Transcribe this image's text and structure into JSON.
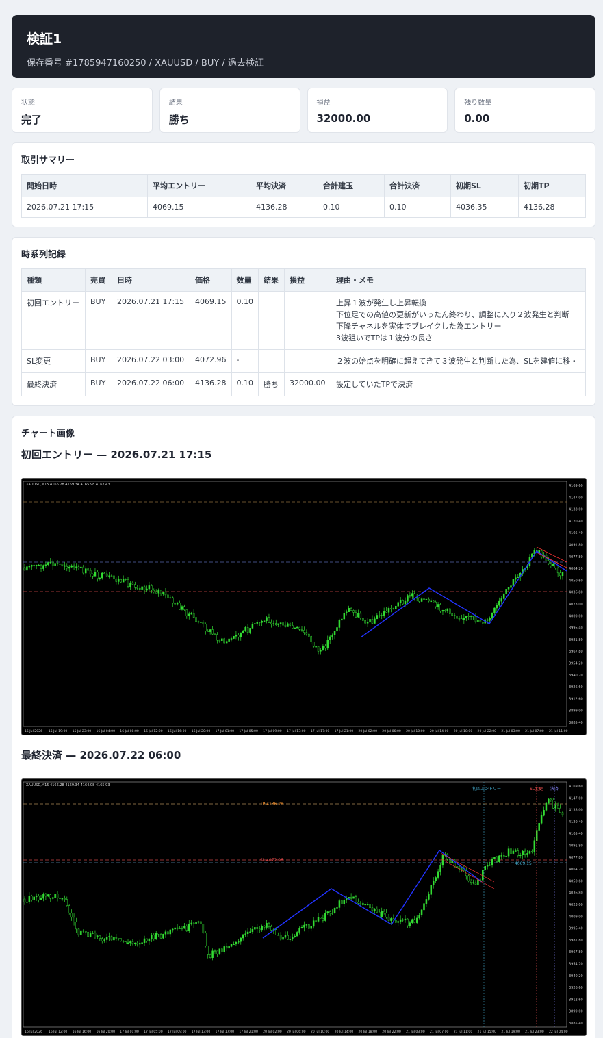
{
  "header": {
    "title": "検証1",
    "subtitle": "保存番号 #1785947160250 / XAUUSD / BUY / 過去検証"
  },
  "stats": [
    {
      "label": "状態",
      "value": "完了"
    },
    {
      "label": "結果",
      "value": "勝ち"
    },
    {
      "label": "損益",
      "value": "32000.00"
    },
    {
      "label": "残り数量",
      "value": "0.00"
    }
  ],
  "summary": {
    "title": "取引サマリー",
    "headers": [
      "開始日時",
      "平均エントリー",
      "平均決済",
      "合計建玉",
      "合計決済",
      "初期SL",
      "初期TP"
    ],
    "row": [
      "2026.07.21 17:15",
      "4069.15",
      "4136.28",
      "0.10",
      "0.10",
      "4036.35",
      "4136.28"
    ]
  },
  "timeline": {
    "title": "時系列記録",
    "headers": [
      "種類",
      "売買",
      "日時",
      "価格",
      "数量",
      "結果",
      "損益",
      "理由・メモ"
    ],
    "rows": [
      {
        "cells": [
          "初回エントリー",
          "BUY",
          "2026.07.21 17:15",
          "4069.15",
          "0.10",
          "",
          ""
        ],
        "memo": [
          "上昇１波が発生し上昇転換",
          "下位足での高値の更新がいったん終わり、調整に入り２波発生と判断",
          "下降チャネルを実体でブレイクした為エントリー",
          "3波狙いでTPは１波分の長さ"
        ]
      },
      {
        "cells": [
          "SL変更",
          "BUY",
          "2026.07.22 03:00",
          "4072.96",
          "-",
          "",
          ""
        ],
        "memo": [
          "２波の始点を明確に超えてきて３波発生と判断した為、SLを建値に移・"
        ]
      },
      {
        "cells": [
          "最終決済",
          "BUY",
          "2026.07.22 06:00",
          "4136.28",
          "0.10",
          "勝ち",
          "32000.00"
        ],
        "memo": [
          "設定していたTPで決済"
        ]
      }
    ]
  },
  "charts_section": {
    "title": "チャート画像",
    "charts": [
      {
        "heading": "初回エントリー — 2026.07.21 17:15",
        "info": "XAUUSD,M15  4166.28 4169.34 4165.98 4167.43",
        "y_ticks": [
          "4169.60",
          "4147.00",
          "4133.00",
          "4120.40",
          "4105.40",
          "4091.80",
          "4077.80",
          "4064.20",
          "4050.60",
          "4036.80",
          "4023.00",
          "4009.00",
          "3995.40",
          "3981.80",
          "3967.80",
          "3954.20",
          "3940.20",
          "3926.60",
          "3912.60",
          "3899.00",
          "3885.40"
        ],
        "x_ticks": [
          "15 Jul 2026",
          "15 Jul 19:00",
          "15 Jul 23:00",
          "16 Jul 04:00",
          "16 Jul 08:00",
          "16 Jul 12:00",
          "16 Jul 16:00",
          "16 Jul 20:00",
          "17 Jul 01:00",
          "17 Jul 05:00",
          "17 Jul 09:00",
          "17 Jul 13:00",
          "17 Jul 17:00",
          "17 Jul 21:00",
          "20 Jul 02:00",
          "20 Jul 06:00",
          "20 Jul 10:00",
          "20 Jul 14:00",
          "20 Jul 18:00",
          "20 Jul 22:00",
          "21 Jul 03:00",
          "21 Jul 07:00",
          "21 Jul 11:00"
        ],
        "labels": []
      },
      {
        "heading": "最終決済 — 2026.07.22 06:00",
        "info": "XAUUSD,M15  4166.28 4169.34 4164.08 4165.93",
        "y_ticks": [
          "4169.60",
          "4147.00",
          "4133.00",
          "4120.40",
          "4105.40",
          "4091.80",
          "4077.80",
          "4064.20",
          "4050.60",
          "4036.80",
          "4023.00",
          "4009.00",
          "3995.40",
          "3981.80",
          "3967.80",
          "3954.20",
          "3940.20",
          "3926.60",
          "3912.60",
          "3899.00",
          "3885.40"
        ],
        "x_ticks": [
          "16 Jul 2026",
          "16 Jul 12:00",
          "16 Jul 16:00",
          "16 Jul 20:00",
          "17 Jul 01:00",
          "17 Jul 05:00",
          "17 Jul 09:00",
          "17 Jul 13:00",
          "17 Jul 17:00",
          "17 Jul 21:00",
          "20 Jul 02:00",
          "20 Jul 06:00",
          "20 Jul 10:00",
          "20 Jul 14:00",
          "20 Jul 18:00",
          "20 Jul 22:00",
          "21 Jul 03:00",
          "21 Jul 07:00",
          "21 Jul 11:00",
          "21 Jul 15:00",
          "21 Jul 19:00",
          "21 Jul 23:00",
          "22 Jul 04:00"
        ],
        "labels": [
          "初回エントリー",
          "SL変更",
          "決済",
          "TP 4136.28",
          "SL 4072.96",
          "4069.15"
        ]
      }
    ]
  },
  "colors": {
    "header_bg": "#1e222b",
    "candle": "#33dd33",
    "wave_line": "#2233ff",
    "tp_line": "#ff9933",
    "sl_line": "#ff4444"
  }
}
